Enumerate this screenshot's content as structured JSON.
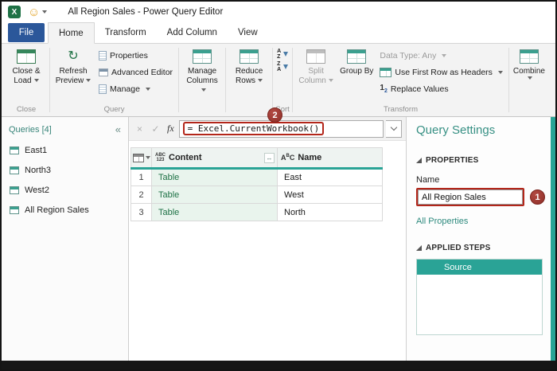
{
  "window": {
    "title": "All Region Sales - Power Query Editor"
  },
  "icons": {
    "excel_logo": "X",
    "smiley": "☺",
    "queries_collapse": "«",
    "formula_cancel": "×",
    "formula_check": "✓",
    "expand_column": "↔",
    "refresh": "↻",
    "replace_one": "1",
    "replace_two": "2",
    "sort_a": "A",
    "sort_z": "Z"
  },
  "tabs": {
    "file": "File",
    "items": [
      "Home",
      "Transform",
      "Add Column",
      "View"
    ],
    "active": "Home"
  },
  "ribbon": {
    "close_load": "Close & Load",
    "refresh_preview": "Refresh Preview",
    "properties": "Properties",
    "advanced_editor": "Advanced Editor",
    "manage": "Manage",
    "manage_columns": "Manage Columns",
    "reduce_rows": "Reduce Rows",
    "split_column": "Split Column",
    "group_by": "Group By",
    "data_type": "Data Type: Any",
    "use_first_row": "Use First Row as Headers",
    "replace_values": "Replace Values",
    "combine": "Combine",
    "groups": {
      "close": "Close",
      "query": "Query",
      "sort": "Sort",
      "transform": "Transform"
    }
  },
  "queries_pane": {
    "header": "Queries [4]",
    "items": [
      "East1",
      "North3",
      "West2",
      "All Region Sales"
    ]
  },
  "formula_bar": {
    "fx": "fx",
    "formula": "= Excel.CurrentWorkbook()"
  },
  "grid": {
    "columns": [
      {
        "type_top": "ABC",
        "type_bottom": "123",
        "name": "Content"
      },
      {
        "type_a": "A",
        "type_b": "B",
        "type_c": "C",
        "name": "Name"
      }
    ],
    "rows": [
      {
        "num": "1",
        "content": "Table",
        "name": "East"
      },
      {
        "num": "2",
        "content": "Table",
        "name": "West"
      },
      {
        "num": "3",
        "content": "Table",
        "name": "North"
      }
    ]
  },
  "query_settings": {
    "title": "Query Settings",
    "properties_header": "PROPERTIES",
    "name_label": "Name",
    "name_value": "All Region Sales",
    "all_properties_link": "All Properties",
    "applied_steps_header": "APPLIED STEPS",
    "steps": [
      {
        "label": "Source"
      }
    ]
  },
  "annotations": {
    "badge_1": "1",
    "badge_2": "2"
  },
  "colors": {
    "accent_teal": "#2aa396",
    "file_tab_blue": "#2b579a",
    "annotation_red": "#a03b35",
    "table_link_green": "#1f7246",
    "excel_green": "#1e7145"
  }
}
